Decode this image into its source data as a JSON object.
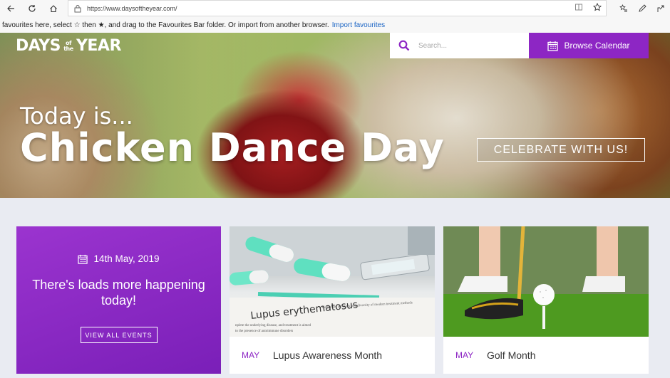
{
  "browser": {
    "url": "https://www.daysoftheyear.com/",
    "favourites_text": "favourites here, select ☆ then ★, and drag to the Favourites Bar folder. Or import from another browser.",
    "import_link": "Import favourites"
  },
  "site": {
    "logo_days": "DAYS",
    "logo_of": "of the",
    "logo_year": "YEAR",
    "search_placeholder": "Search...",
    "browse_label": "Browse Calendar"
  },
  "hero": {
    "kicker": "Today is...",
    "title": "Chicken Dance Day",
    "cta": "CELEBRATE WITH US!"
  },
  "today_card": {
    "date": "14th May, 2019",
    "message": "There's loads more happening today!",
    "button": "VIEW ALL EVENTS"
  },
  "events": [
    {
      "month": "MAY",
      "title": "Lupus Awareness Month",
      "image_text": "Lupus erythematosus"
    },
    {
      "month": "MAY",
      "title": "Golf Month"
    }
  ],
  "colors": {
    "brand_purple": "#8d26c4",
    "page_bg": "#e9ebf2"
  }
}
